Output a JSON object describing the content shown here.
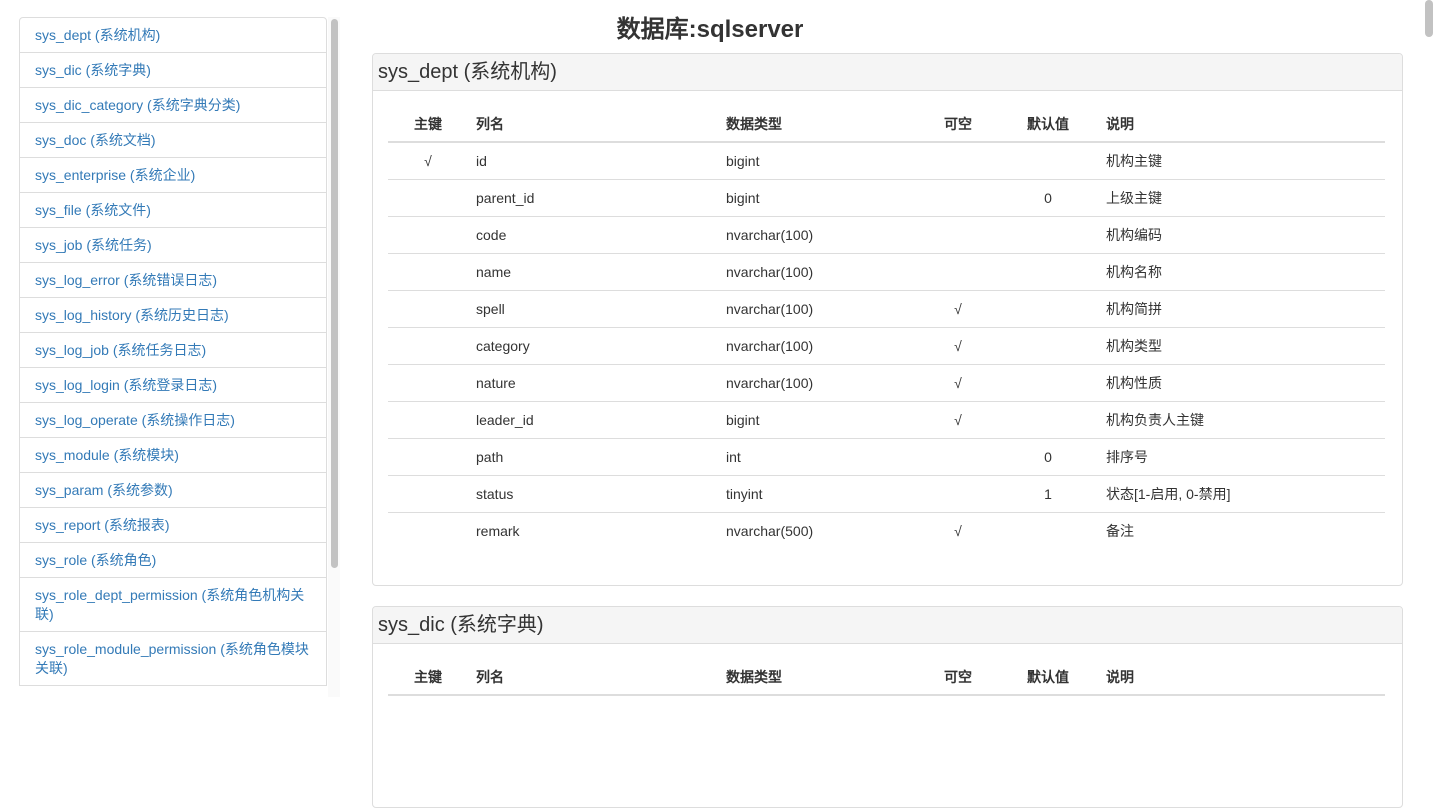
{
  "title": "数据库:sqlserver",
  "sidebar": {
    "items": [
      "sys_dept (系统机构)",
      "sys_dic (系统字典)",
      "sys_dic_category (系统字典分类)",
      "sys_doc (系统文档)",
      "sys_enterprise (系统企业)",
      "sys_file (系统文件)",
      "sys_job (系统任务)",
      "sys_log_error (系统错误日志)",
      "sys_log_history (系统历史日志)",
      "sys_log_job (系统任务日志)",
      "sys_log_login (系统登录日志)",
      "sys_log_operate (系统操作日志)",
      "sys_module (系统模块)",
      "sys_param (系统参数)",
      "sys_report (系统报表)",
      "sys_role (系统角色)",
      "sys_role_dept_permission (系统角色机构关联)",
      "sys_role_module_permission (系统角色模块关联)"
    ]
  },
  "columns": [
    "主键",
    "列名",
    "数据类型",
    "可空",
    "默认值",
    "说明"
  ],
  "tables": [
    {
      "title": "sys_dept (系统机构)",
      "rows": [
        [
          "√",
          "id",
          "bigint",
          "",
          "",
          "机构主键"
        ],
        [
          "",
          "parent_id",
          "bigint",
          "",
          "0",
          "上级主键"
        ],
        [
          "",
          "code",
          "nvarchar(100)",
          "",
          "",
          "机构编码"
        ],
        [
          "",
          "name",
          "nvarchar(100)",
          "",
          "",
          "机构名称"
        ],
        [
          "",
          "spell",
          "nvarchar(100)",
          "√",
          "",
          "机构简拼"
        ],
        [
          "",
          "category",
          "nvarchar(100)",
          "√",
          "",
          "机构类型"
        ],
        [
          "",
          "nature",
          "nvarchar(100)",
          "√",
          "",
          "机构性质"
        ],
        [
          "",
          "leader_id",
          "bigint",
          "√",
          "",
          "机构负责人主键"
        ],
        [
          "",
          "path",
          "int",
          "",
          "0",
          "排序号"
        ],
        [
          "",
          "status",
          "tinyint",
          "",
          "1",
          "状态[1-启用, 0-禁用]"
        ],
        [
          "",
          "remark",
          "nvarchar(500)",
          "√",
          "",
          "备注"
        ]
      ]
    },
    {
      "title": "sys_dic (系统字典)",
      "rows": []
    }
  ]
}
